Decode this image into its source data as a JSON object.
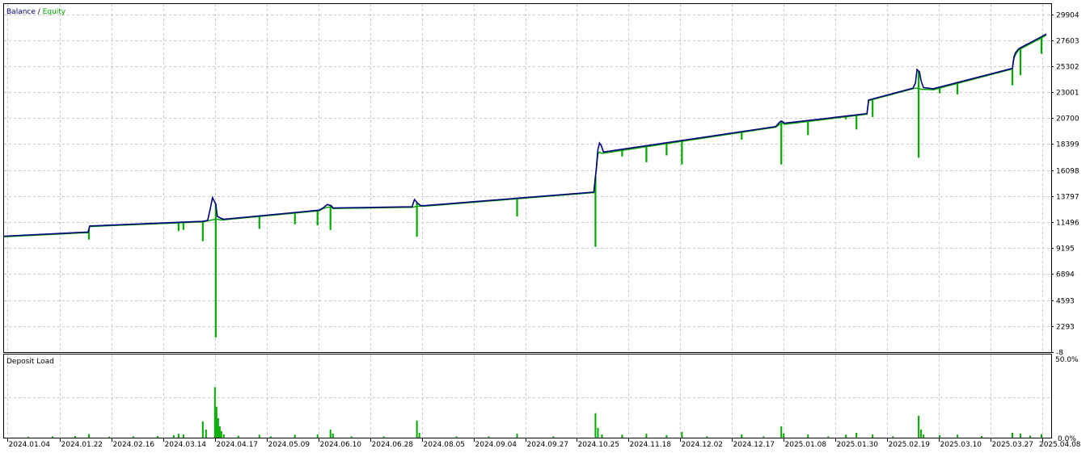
{
  "legend": {
    "balance_label": "Balance",
    "separator": " / ",
    "equity_label": "Equity",
    "balance_color": "#000080",
    "equity_color": "#00aa00"
  },
  "load_panel": {
    "title": "Deposit Load",
    "color": "#00aa00",
    "y_ticks": [
      "50.0%",
      "0.0%"
    ]
  },
  "chart_data": [
    {
      "type": "line",
      "title": "",
      "series": [
        {
          "name": "Balance",
          "color": "#000080",
          "x": [
            0,
            100,
            104,
            106,
            240,
            245,
            252,
            255,
            258,
            262,
            264,
            268,
            272,
            390,
            395,
            400,
            405,
            407,
            505,
            508,
            512,
            516,
            520,
            730,
            733,
            735,
            737,
            739,
            742,
            955,
            960,
            962,
            964,
            966,
            1068,
            1070,
            1125,
            1128,
            1130,
            1133,
            1135,
            1138,
            1150,
            1248,
            1250,
            1252,
            1256,
            1285,
            1290
          ],
          "y": [
            10250,
            10600,
            10600,
            11150,
            11550,
            11550,
            11650,
            12600,
            13650,
            13100,
            12000,
            11850,
            11750,
            12550,
            12750,
            13050,
            12950,
            12750,
            12850,
            13500,
            13150,
            12950,
            12950,
            14150,
            16200,
            17900,
            18500,
            18300,
            17700,
            19950,
            20350,
            20450,
            20350,
            20250,
            21100,
            22300,
            23350,
            23800,
            25000,
            24800,
            24000,
            23400,
            23300,
            25100,
            26150,
            26500,
            26850,
            27950,
            28150
          ]
        },
        {
          "name": "Equity",
          "color": "#00aa00",
          "x": [
            0,
            100,
            104,
            106,
            240,
            245,
            252,
            258,
            262,
            264,
            268,
            272,
            390,
            395,
            400,
            405,
            407,
            505,
            508,
            512,
            516,
            520,
            730,
            733,
            735,
            737,
            739,
            742,
            955,
            960,
            962,
            964,
            966,
            1068,
            1070,
            1125,
            1128,
            1130,
            1133,
            1135,
            1138,
            1150,
            1248,
            1250,
            1252,
            1256,
            1285,
            1290
          ],
          "y": [
            10200,
            10550,
            10550,
            11100,
            11500,
            11500,
            11600,
            11700,
            11750,
            11750,
            11700,
            11700,
            12500,
            12700,
            12800,
            12850,
            12700,
            12800,
            12850,
            12900,
            12900,
            12900,
            14100,
            16100,
            17500,
            17700,
            17600,
            17600,
            19900,
            20150,
            20250,
            20250,
            20150,
            21050,
            22250,
            23300,
            23350,
            23350,
            23300,
            23250,
            23250,
            23200,
            25050,
            26000,
            26350,
            26750,
            27850,
            28050
          ]
        }
      ],
      "spikes": [
        {
          "x": 105,
          "low": 9950
        },
        {
          "x": 216,
          "low": 10700
        },
        {
          "x": 222,
          "low": 10800
        },
        {
          "x": 246,
          "low": 9800
        },
        {
          "x": 262,
          "low": 1300
        },
        {
          "x": 316,
          "low": 10900
        },
        {
          "x": 360,
          "low": 11300
        },
        {
          "x": 388,
          "low": 11200
        },
        {
          "x": 404,
          "low": 10800
        },
        {
          "x": 511,
          "low": 10200
        },
        {
          "x": 635,
          "low": 12000
        },
        {
          "x": 732,
          "low": 9300
        },
        {
          "x": 765,
          "low": 17300
        },
        {
          "x": 795,
          "low": 16800
        },
        {
          "x": 820,
          "low": 17400
        },
        {
          "x": 839,
          "low": 16600
        },
        {
          "x": 913,
          "low": 18800
        },
        {
          "x": 962,
          "low": 16600
        },
        {
          "x": 995,
          "low": 19200
        },
        {
          "x": 1042,
          "low": 20600
        },
        {
          "x": 1055,
          "low": 19700
        },
        {
          "x": 1075,
          "low": 20800
        },
        {
          "x": 1132,
          "low": 17200
        },
        {
          "x": 1158,
          "low": 22900
        },
        {
          "x": 1180,
          "low": 22800
        },
        {
          "x": 1248,
          "low": 23600
        },
        {
          "x": 1258,
          "low": 24500
        },
        {
          "x": 1284,
          "low": 26400
        }
      ],
      "x_domain": [
        0,
        1296
      ],
      "ylim": [
        -8,
        30800
      ],
      "y_ticks": [
        29904,
        27603,
        25302,
        23001,
        20700,
        18399,
        16098,
        13797,
        11496,
        9195,
        6894,
        4593,
        2293,
        -8
      ],
      "x_ticks": [
        {
          "label": "2024.01.04",
          "x": 4
        },
        {
          "label": "2024.01.22",
          "x": 69
        },
        {
          "label": "2024.02.16",
          "x": 133
        },
        {
          "label": "2024.03.14",
          "x": 197
        },
        {
          "label": "2024.04.17",
          "x": 261
        },
        {
          "label": "2024.05.09",
          "x": 325
        },
        {
          "label": "2024.06.10",
          "x": 389
        },
        {
          "label": "2024.06.28",
          "x": 453
        },
        {
          "label": "2024.08.05",
          "x": 517
        },
        {
          "label": "2024.09.04",
          "x": 581
        },
        {
          "label": "2024.09.27",
          "x": 645
        },
        {
          "label": "2024.10.25",
          "x": 709
        },
        {
          "label": "2024.11.18",
          "x": 773
        },
        {
          "label": "2024.12.02",
          "x": 837
        },
        {
          "label": "2024.12.17",
          "x": 901
        },
        {
          "label": "2025.01.08",
          "x": 965
        },
        {
          "label": "2025.01.30",
          "x": 1029
        },
        {
          "label": "2025.02.19",
          "x": 1093
        },
        {
          "label": "2025.03.10",
          "x": 1157
        },
        {
          "label": "2025.03.27",
          "x": 1221
        },
        {
          "label": "2025.04.08",
          "x": 1285
        }
      ],
      "grid": true
    },
    {
      "type": "bar",
      "title": "Deposit Load",
      "ylim": [
        0,
        50
      ],
      "bars": [
        {
          "x": 30,
          "v": 0.6
        },
        {
          "x": 60,
          "v": 0.8
        },
        {
          "x": 88,
          "v": 1.0
        },
        {
          "x": 105,
          "v": 2.2
        },
        {
          "x": 130,
          "v": 0.6
        },
        {
          "x": 160,
          "v": 0.8
        },
        {
          "x": 190,
          "v": 1.0
        },
        {
          "x": 210,
          "v": 1.5
        },
        {
          "x": 216,
          "v": 2.4
        },
        {
          "x": 222,
          "v": 2.0
        },
        {
          "x": 246,
          "v": 10.0
        },
        {
          "x": 250,
          "v": 5.0
        },
        {
          "x": 261,
          "v": 31.0
        },
        {
          "x": 263,
          "v": 19.0
        },
        {
          "x": 265,
          "v": 12.0
        },
        {
          "x": 267,
          "v": 7.0
        },
        {
          "x": 269,
          "v": 4.0
        },
        {
          "x": 272,
          "v": 2.0
        },
        {
          "x": 290,
          "v": 1.2
        },
        {
          "x": 316,
          "v": 1.8
        },
        {
          "x": 330,
          "v": 0.8
        },
        {
          "x": 360,
          "v": 1.8
        },
        {
          "x": 388,
          "v": 2.0
        },
        {
          "x": 404,
          "v": 5.0
        },
        {
          "x": 407,
          "v": 2.5
        },
        {
          "x": 430,
          "v": 0.8
        },
        {
          "x": 470,
          "v": 0.8
        },
        {
          "x": 511,
          "v": 10.5
        },
        {
          "x": 514,
          "v": 3.0
        },
        {
          "x": 560,
          "v": 0.8
        },
        {
          "x": 600,
          "v": 0.8
        },
        {
          "x": 635,
          "v": 2.5
        },
        {
          "x": 680,
          "v": 0.8
        },
        {
          "x": 732,
          "v": 15.0
        },
        {
          "x": 735,
          "v": 6.0
        },
        {
          "x": 740,
          "v": 2.0
        },
        {
          "x": 765,
          "v": 1.8
        },
        {
          "x": 795,
          "v": 2.5
        },
        {
          "x": 820,
          "v": 1.5
        },
        {
          "x": 839,
          "v": 3.5
        },
        {
          "x": 870,
          "v": 0.8
        },
        {
          "x": 913,
          "v": 2.0
        },
        {
          "x": 940,
          "v": 0.8
        },
        {
          "x": 962,
          "v": 7.0
        },
        {
          "x": 965,
          "v": 2.5
        },
        {
          "x": 995,
          "v": 2.0
        },
        {
          "x": 1020,
          "v": 0.8
        },
        {
          "x": 1042,
          "v": 1.8
        },
        {
          "x": 1055,
          "v": 3.0
        },
        {
          "x": 1075,
          "v": 2.0
        },
        {
          "x": 1100,
          "v": 0.8
        },
        {
          "x": 1132,
          "v": 13.5
        },
        {
          "x": 1135,
          "v": 5.0
        },
        {
          "x": 1138,
          "v": 2.0
        },
        {
          "x": 1158,
          "v": 1.5
        },
        {
          "x": 1180,
          "v": 1.8
        },
        {
          "x": 1210,
          "v": 1.0
        },
        {
          "x": 1248,
          "v": 3.0
        },
        {
          "x": 1258,
          "v": 2.5
        },
        {
          "x": 1270,
          "v": 1.2
        },
        {
          "x": 1284,
          "v": 2.2
        }
      ]
    }
  ]
}
